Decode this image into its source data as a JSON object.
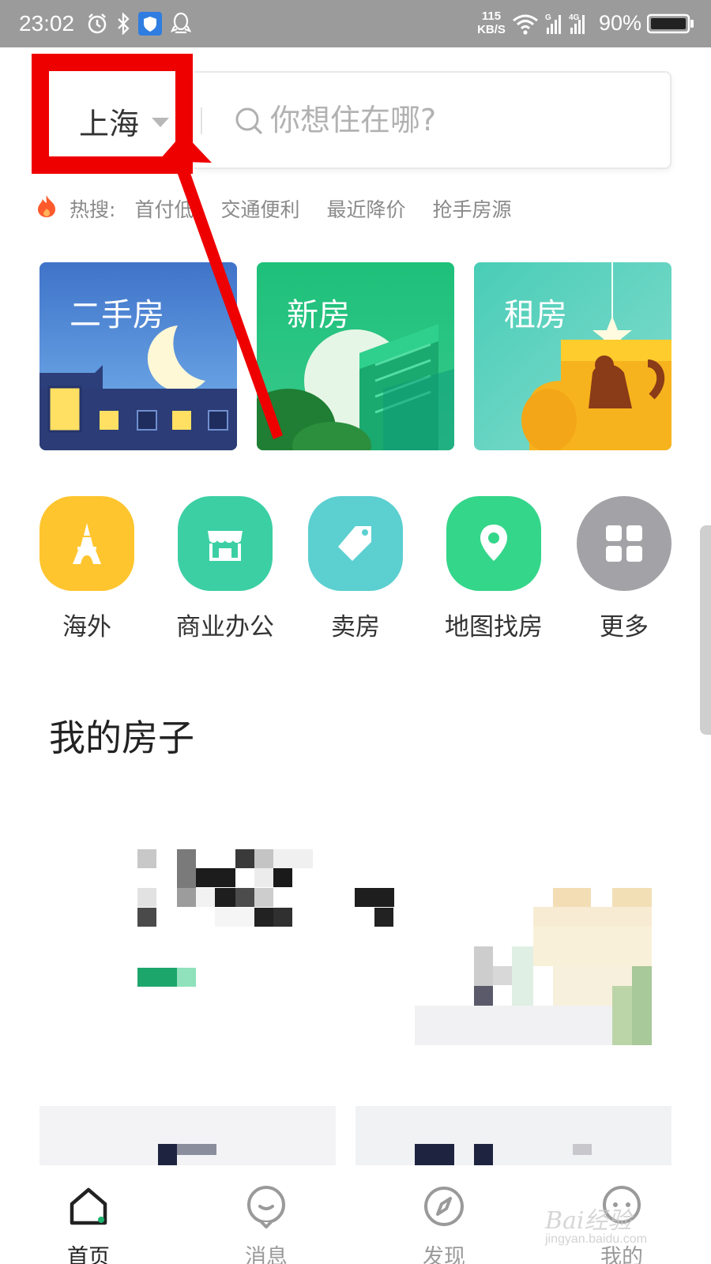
{
  "status_bar": {
    "time": "23:02",
    "network_speed_value": "115",
    "network_speed_unit": "KB/S",
    "network_type": "4G",
    "battery": "90%",
    "icons": [
      "alarm-icon",
      "bluetooth-icon",
      "shield-icon",
      "qq-icon",
      "wifi-icon",
      "signal-icon",
      "battery-icon"
    ]
  },
  "header": {
    "city": "上海",
    "search_placeholder": "你想住在哪?"
  },
  "hot_search": {
    "label": "热搜:",
    "tags": [
      "首付低",
      "交通便利",
      "最近降价",
      "抢手房源"
    ]
  },
  "categories": [
    {
      "title": "二手房"
    },
    {
      "title": "新房"
    },
    {
      "title": "租房"
    }
  ],
  "quick_links": [
    {
      "label": "海外",
      "icon": "eiffel-tower-icon",
      "color": "#FFC52E"
    },
    {
      "label": "商业办公",
      "icon": "shop-icon",
      "color": "#3CCFA4"
    },
    {
      "label": "卖房",
      "icon": "price-tag-icon",
      "color": "#5CCFD0"
    },
    {
      "label": "地图找房",
      "icon": "map-pin-icon",
      "color": "#34D68A"
    },
    {
      "label": "更多",
      "icon": "grid-icon",
      "color": "#A3A3A7"
    }
  ],
  "my_house": {
    "title": "我的房子"
  },
  "bottom_nav": [
    {
      "label": "首页",
      "icon": "home-icon",
      "active": true
    },
    {
      "label": "消息",
      "icon": "message-icon",
      "active": false
    },
    {
      "label": "发现",
      "icon": "compass-icon",
      "active": false
    },
    {
      "label": "我的",
      "icon": "profile-icon",
      "active": false
    }
  ],
  "watermark": {
    "text": "Bai经验",
    "sub": "jingyan.baidu.com"
  },
  "colors": {
    "annotation_red": "#EE0000",
    "accent_green": "#1DB36F"
  }
}
